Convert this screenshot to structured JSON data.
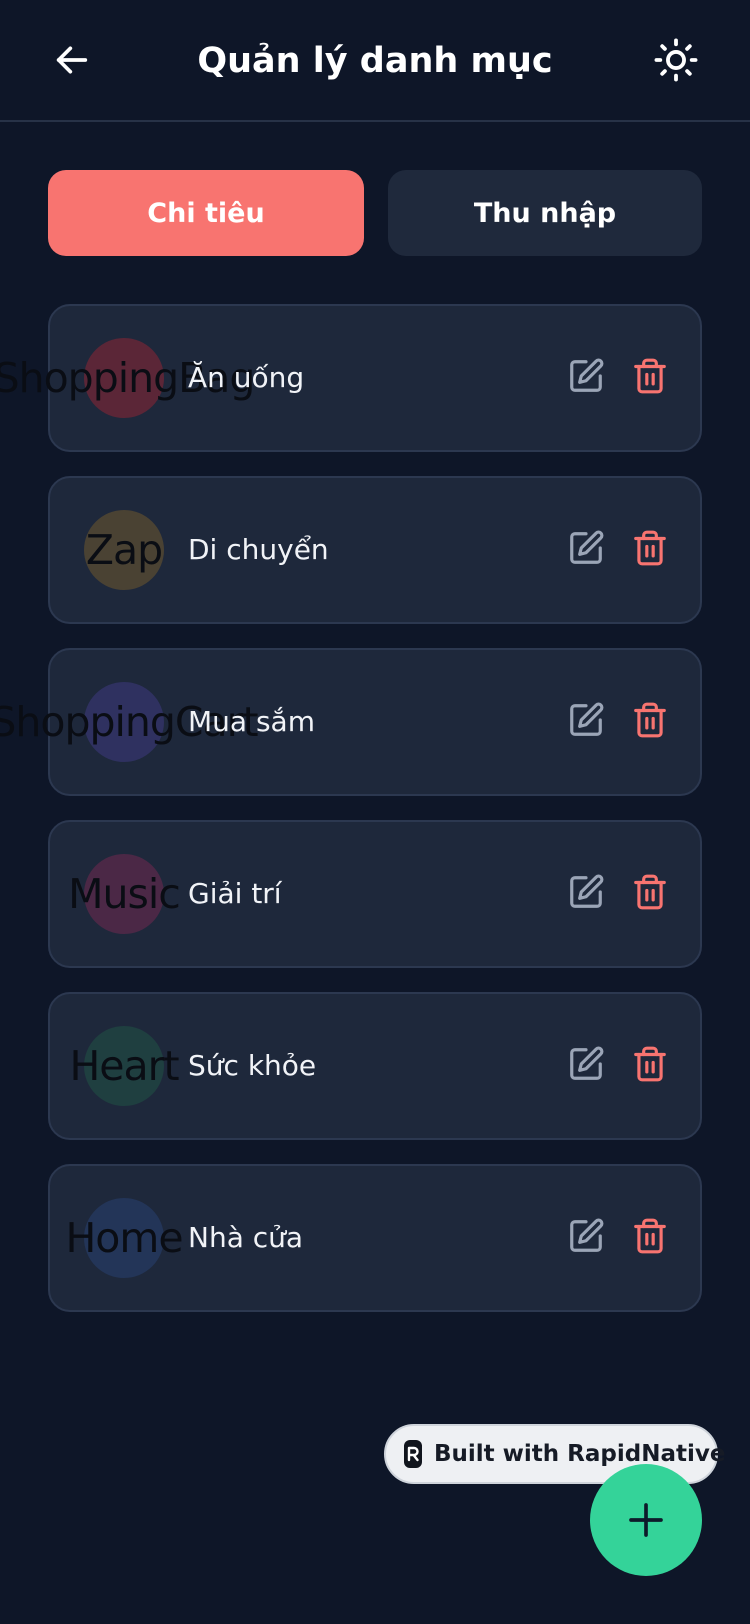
{
  "header": {
    "title": "Quản lý danh mục",
    "back_icon": "arrow-left-icon",
    "theme_icon": "sun-icon"
  },
  "tabs": [
    {
      "label": "Chi tiêu",
      "active": true
    },
    {
      "label": "Thu nhập",
      "active": false
    }
  ],
  "categories": [
    {
      "name": "Ăn uống",
      "icon_name": "ShoppingBag",
      "icon_bg": "#5b2637"
    },
    {
      "name": "Di chuyển",
      "icon_name": "Zap",
      "icon_bg": "#4a4233"
    },
    {
      "name": "Mua sắm",
      "icon_name": "ShoppingCart",
      "icon_bg": "#2f3160"
    },
    {
      "name": "Giải trí",
      "icon_name": "Music",
      "icon_bg": "#4b2846"
    },
    {
      "name": "Sức khỏe",
      "icon_name": "Heart",
      "icon_bg": "#1f3f40"
    },
    {
      "name": "Nhà cửa",
      "icon_name": "Home",
      "icon_bg": "#233558"
    }
  ],
  "actions": {
    "edit_icon": "edit-icon",
    "delete_icon": "trash-icon"
  },
  "badge": {
    "label": "Built with RapidNative"
  },
  "fab": {
    "icon": "plus-icon"
  },
  "colors": {
    "background": "#0e1628",
    "card": "#1e283b",
    "accent_expense": "#f87470",
    "fab": "#34d399",
    "edit": "#9ba5b7",
    "delete": "#f87470"
  }
}
